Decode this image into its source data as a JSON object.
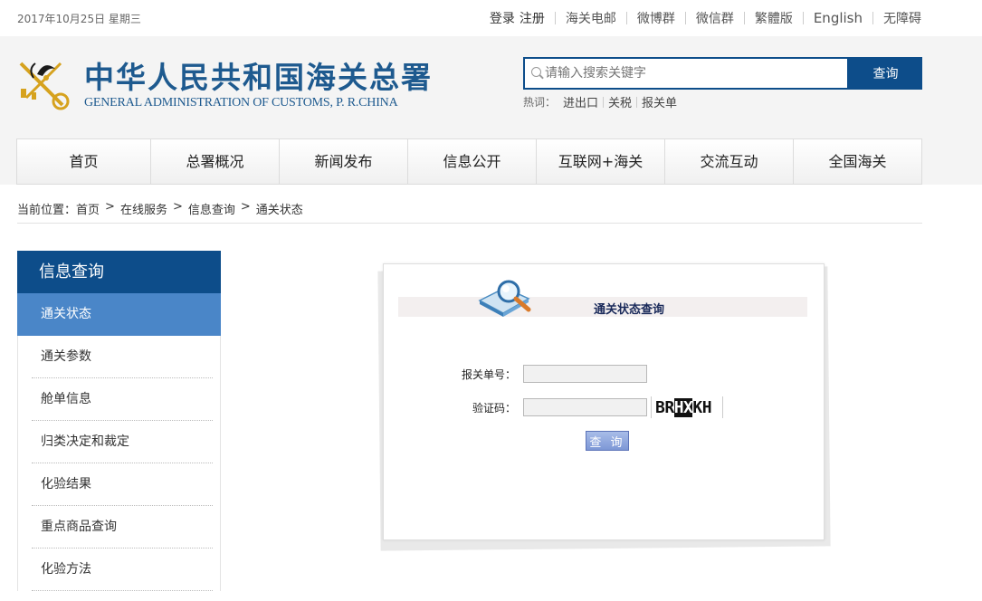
{
  "topbar": {
    "date": "2017年10月25日 星期三",
    "login": "登录",
    "register": "注册",
    "links": [
      "海关电邮",
      "微博群",
      "微信群",
      "繁體版",
      "English",
      "无障碍"
    ]
  },
  "header": {
    "logo_cn": "中华人民共和国海关总署",
    "logo_en": "GENERAL ADMINISTRATION OF CUSTOMS, P. R.CHINA",
    "search": {
      "placeholder": "请输入搜索关键字",
      "button": "查询"
    },
    "hot": {
      "label": "热词：",
      "words": [
        "进出口",
        "关税",
        "报关单"
      ]
    }
  },
  "nav": {
    "items": [
      "首页",
      "总署概况",
      "新闻发布",
      "信息公开",
      "互联网+海关",
      "交流互动",
      "全国海关"
    ]
  },
  "breadcrumb": {
    "label": "当前位置：",
    "items": [
      "首页",
      "在线服务",
      "信息查询",
      "通关状态"
    ],
    "separator": ">"
  },
  "sidebar": {
    "title": "信息查询",
    "items": [
      "通关状态",
      "通关参数",
      "舱单信息",
      "归类决定和裁定",
      "化验结果",
      "重点商品查询",
      "化验方法"
    ],
    "active_index": 0
  },
  "panel": {
    "title": "通关状态查询",
    "declaration_label": "报关单号：",
    "declaration_value": "",
    "captcha_label": "验证码：",
    "captcha_value": "",
    "captcha": {
      "pre": "BR",
      "mid": "HX",
      "post": "KH"
    },
    "submit": "查 询"
  },
  "colors": {
    "brand": "#0d4d8a",
    "active": "#4a86c8",
    "header_bg": "#f4f4f4"
  }
}
